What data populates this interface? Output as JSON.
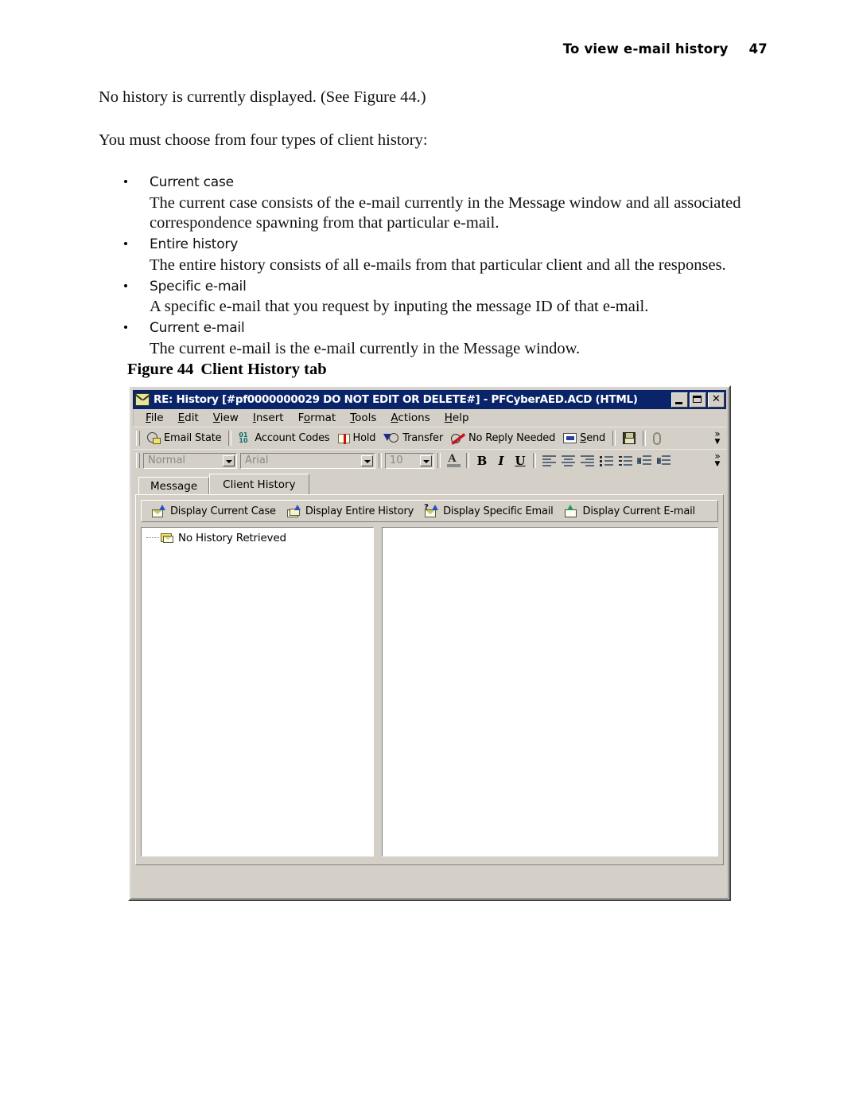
{
  "page": {
    "header_title": "To view e-mail history",
    "page_number": "47"
  },
  "body": {
    "intro_paragraph": "No history is currently displayed. (See Figure 44.)",
    "lead_in": "You must choose from four types of client history:",
    "bullets": [
      {
        "label": "Current case",
        "description": "The current case consists of the e-mail currently in the Message window and all associated correspondence spawning from that particular e-mail."
      },
      {
        "label": "Entire history",
        "description": "The entire history consists of all e-mails from that particular client and all the responses."
      },
      {
        "label": "Specific e-mail",
        "description": "A specific e-mail that you request by inputing the message ID of that e-mail."
      },
      {
        "label": "Current e-mail",
        "description": "The current e-mail is the e-mail currently in the Message window."
      }
    ],
    "figure_caption_number": "Figure 44",
    "figure_caption_text": "Client History tab"
  },
  "window": {
    "title": "RE: History [#pf0000000029 DO NOT EDIT OR DELETE#] - PFCyberAED.ACD (HTML)",
    "title_icon": "envelope-icon",
    "controls": [
      {
        "name": "minimize-button",
        "glyph": "_"
      },
      {
        "name": "maximize-button",
        "glyph": "□"
      },
      {
        "name": "close-button",
        "glyph": "×"
      }
    ],
    "menu": [
      {
        "accel": "F",
        "rest": "ile"
      },
      {
        "accel": "E",
        "rest": "dit"
      },
      {
        "accel": "V",
        "rest": "iew"
      },
      {
        "accel": "I",
        "rest": "nsert"
      },
      {
        "pre": "F",
        "accel": "o",
        "rest": "rmat"
      },
      {
        "accel": "T",
        "rest": "ools"
      },
      {
        "accel": "A",
        "rest": "ctions"
      },
      {
        "accel": "H",
        "rest": "elp"
      }
    ],
    "toolbar_main": {
      "buttons": [
        {
          "label": "Email State",
          "icon": "email-state-icon"
        },
        {
          "label": "Account Codes",
          "icon": "account-codes-icon"
        },
        {
          "label": "Hold",
          "icon": "hold-icon"
        },
        {
          "label": "Transfer",
          "icon": "transfer-icon"
        },
        {
          "label": "No Reply Needed",
          "icon": "no-reply-needed-icon"
        },
        {
          "label": "Send",
          "icon": "send-icon",
          "accel": "S"
        }
      ],
      "save_icon": "save-icon",
      "attach_icon": "paperclip-icon",
      "overflow": "»"
    },
    "toolbar_format": {
      "style_value": "Normal",
      "font_value": "Arial",
      "size_value": "10",
      "font_color_icon": "font-color-icon",
      "bold": "B",
      "italic": "I",
      "underline": "U",
      "align_left_icon": "align-left-icon",
      "align_center_icon": "align-center-icon",
      "align_right_icon": "align-right-icon",
      "bullet_list_icon": "bullet-list-icon",
      "numbered_list_icon": "numbered-list-icon",
      "outdent_icon": "outdent-icon",
      "indent_icon": "indent-icon",
      "overflow": "»"
    },
    "tabs": [
      {
        "label": "Message",
        "active": false
      },
      {
        "label": "Client History",
        "active": true
      }
    ],
    "history_toolbar": [
      {
        "label": "Display Current Case",
        "icon": "display-current-case-icon"
      },
      {
        "label": "Display Entire History",
        "icon": "display-entire-history-icon"
      },
      {
        "label": "Display Specific Email",
        "icon": "display-specific-email-icon"
      },
      {
        "label": "Display Current E-mail",
        "icon": "display-current-email-icon"
      }
    ],
    "tree": {
      "node_label": "No History Retrieved",
      "node_icon": "folder-envelope-icon"
    },
    "preview_pane_content": ""
  }
}
